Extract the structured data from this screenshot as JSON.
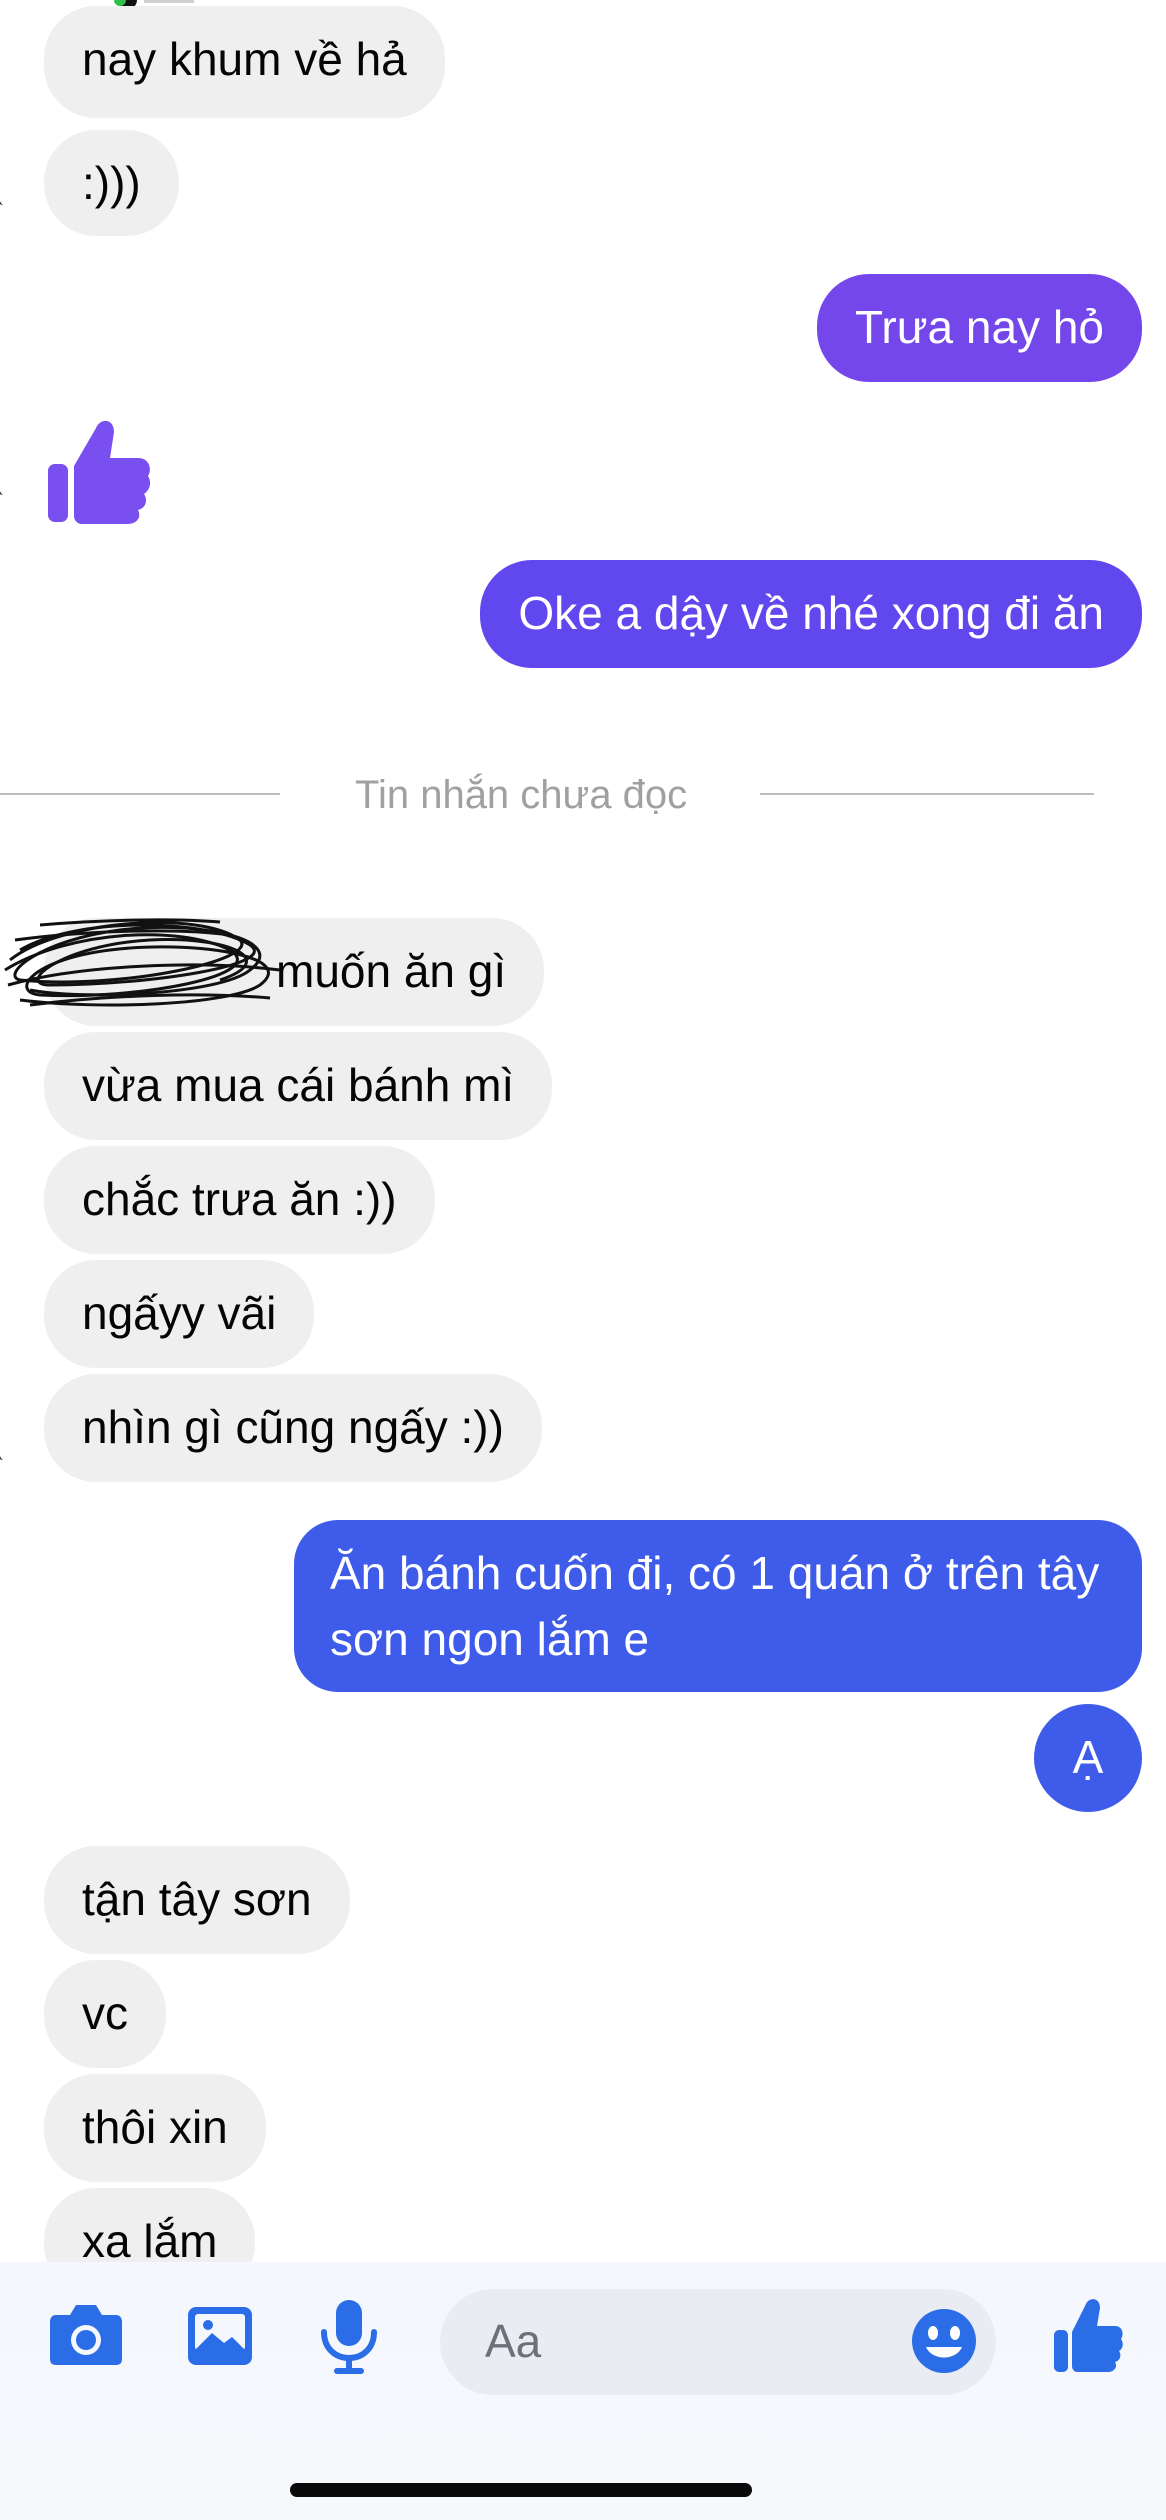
{
  "messages": {
    "m1": "nay khum về hả",
    "m2": ":)))",
    "m3": "Trưa nay hỏ",
    "m4": "Oke a dậy về nhé xong đi ăn",
    "m5": "muốn ăn gì",
    "m6": "vừa mua cái bánh mì",
    "m7": "chắc trưa ăn :))",
    "m8": "ngấyy vãi",
    "m9": "nhìn gì cũng ngấy :))",
    "m10": "Ăn bánh cuốn đi, có 1 quán ở trên tây sơn ngon lắm e",
    "m11": "Ạ",
    "m12": "tận tây sơn",
    "m13": "vc",
    "m14": "thôi xin",
    "m15": "xa lắm"
  },
  "divider": {
    "label": "Tin nhắn chưa đọc"
  },
  "composer": {
    "placeholder": "Aa",
    "icons": [
      "camera-icon",
      "photo-icon",
      "microphone-icon",
      "emoji-icon",
      "thumbs-up-icon"
    ]
  },
  "colors": {
    "incoming_bubble": "#efefef",
    "outgoing_purple": "#7347ea",
    "outgoing_violet": "#6148ee",
    "outgoing_blue": "#3e5ce9",
    "accent_icons": "#2b6de6",
    "reaction_like": "#7a4ff0"
  }
}
